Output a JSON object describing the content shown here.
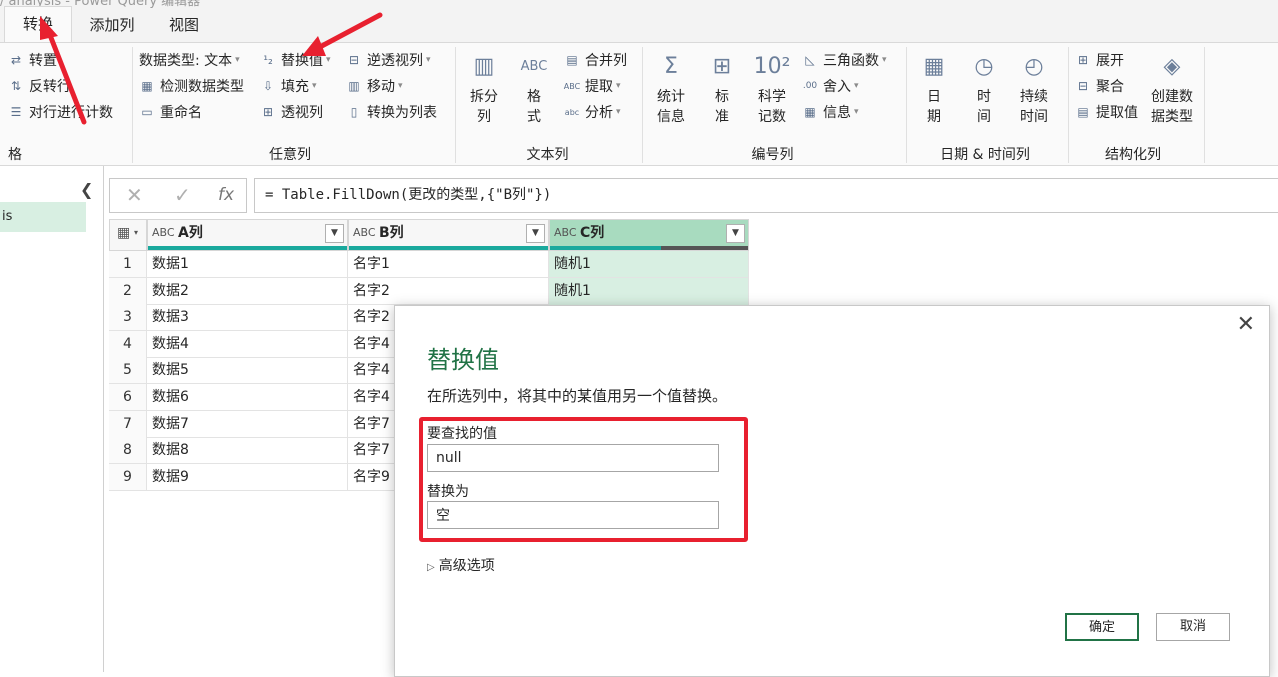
{
  "title_fragment": "/ analysis - Power Query 编辑器",
  "tabs": [
    {
      "label": "转换",
      "active": true
    },
    {
      "label": "添加列",
      "active": false
    },
    {
      "label": "视图",
      "active": false
    }
  ],
  "ribbon": {
    "table_group": {
      "items": [
        "转置",
        "反转行",
        "对行进行计数"
      ],
      "label": "格"
    },
    "any_column_group": {
      "data_type": "数据类型: 文本",
      "detect_type": "检测数据类型",
      "rename": "重命名",
      "replace_values": "替换值",
      "fill": "填充",
      "pivot": "透视列",
      "unpivot": "逆透视列",
      "move": "移动",
      "convert_to_list": "转换为列表",
      "label": "任意列"
    },
    "text_column_group": {
      "split": "拆分列",
      "format": "格式",
      "merge": "合并列",
      "extract": "提取",
      "parse": "分析",
      "label": "文本列"
    },
    "number_column_group": {
      "statistics": "统计信息",
      "standard": "标准",
      "scientific": "科学记数",
      "trig": "三角函数",
      "rounding": "舍入",
      "information": "信息",
      "label": "编号列"
    },
    "datetime_group": {
      "date": "日期",
      "time": "时间",
      "duration": "持续时间",
      "label": "日期 & 时间列"
    },
    "structured_group": {
      "expand": "展开",
      "aggregate": "聚合",
      "extract_values": "提取值",
      "create_type": "创建数据类型",
      "label": "结构化列"
    }
  },
  "left_pane": {
    "query_name": "is"
  },
  "formula_bar": {
    "cancel_icon": "close-icon",
    "confirm_icon": "check-icon",
    "fx": "fx",
    "formula": "= Table.FillDown(更改的类型,{\"B列\"})"
  },
  "grid": {
    "type_icon": "ABC",
    "columns": [
      "A列",
      "B列",
      "C列"
    ],
    "rows": [
      {
        "n": "1",
        "a": "数据1",
        "b": "名字1",
        "c": "随机1"
      },
      {
        "n": "2",
        "a": "数据2",
        "b": "名字2",
        "c": "随机1"
      },
      {
        "n": "3",
        "a": "数据3",
        "b": "名字2",
        "c": ""
      },
      {
        "n": "4",
        "a": "数据4",
        "b": "名字4",
        "c": ""
      },
      {
        "n": "5",
        "a": "数据5",
        "b": "名字4",
        "c": ""
      },
      {
        "n": "6",
        "a": "数据6",
        "b": "名字4",
        "c": ""
      },
      {
        "n": "7",
        "a": "数据7",
        "b": "名字7",
        "c": ""
      },
      {
        "n": "8",
        "a": "数据8",
        "b": "名字7",
        "c": ""
      },
      {
        "n": "9",
        "a": "数据9",
        "b": "名字9",
        "c": ""
      }
    ]
  },
  "dialog": {
    "title": "替换值",
    "description": "在所选列中，将其中的某值用另一个值替换。",
    "find_label": "要查找的值",
    "find_value": "null",
    "replace_label": "替换为",
    "replace_value": "空",
    "advanced": "高级选项",
    "ok": "确定",
    "cancel": "取消"
  },
  "colors": {
    "accent_green": "#217346",
    "selection": "#d8efe2",
    "header_bar": "#1aa99d",
    "annotation_red": "#e8202f"
  }
}
